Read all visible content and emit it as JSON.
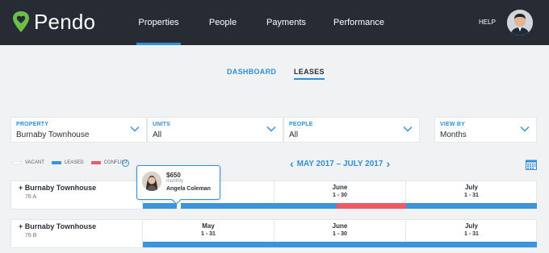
{
  "app": {
    "brand": "Pendo",
    "icons": {
      "logo": "heart-location-pin-icon"
    }
  },
  "colors": {
    "nav_bg": "#272b33",
    "accent": "#2f8fd7",
    "leased": "#3a95dd",
    "conflict": "#ef5a64",
    "vacant": "#ffffff"
  },
  "nav": {
    "items": [
      {
        "label": "Properties",
        "active": true
      },
      {
        "label": "People",
        "active": false
      },
      {
        "label": "Payments",
        "active": false
      },
      {
        "label": "Performance",
        "active": false
      }
    ],
    "help": "HELP"
  },
  "subtabs": {
    "dashboard": "DASHBOARD",
    "leases": "LEASES",
    "active": "LEASES"
  },
  "filters": [
    {
      "label": "PROPERTY",
      "value": "Burnaby Townhouse"
    },
    {
      "label": "UNITS",
      "value": "All"
    },
    {
      "label": "PEOPLE",
      "value": "All"
    },
    {
      "label": "VIEW BY",
      "value": "Months"
    }
  ],
  "legend": {
    "vacant": "VACANT",
    "leased": "LEASED",
    "conflict": "CONFLICT",
    "help": "?"
  },
  "period": {
    "label": "MAY 2017 – JULY 2017",
    "prev": "‹",
    "next": "›"
  },
  "months": [
    {
      "name": "May",
      "range": "1 - 31"
    },
    {
      "name": "June",
      "range": "1 - 30"
    },
    {
      "name": "July",
      "range": "1 - 31"
    }
  ],
  "units": [
    {
      "toggle": "+",
      "property": "Burnaby Townhouse",
      "unit": "76 A"
    },
    {
      "toggle": "+",
      "property": "Burnaby Townhouse",
      "unit": "76 B"
    }
  ],
  "popover": {
    "price": "$650",
    "frequency": "monthly",
    "tenant": "Angela Coleman"
  }
}
